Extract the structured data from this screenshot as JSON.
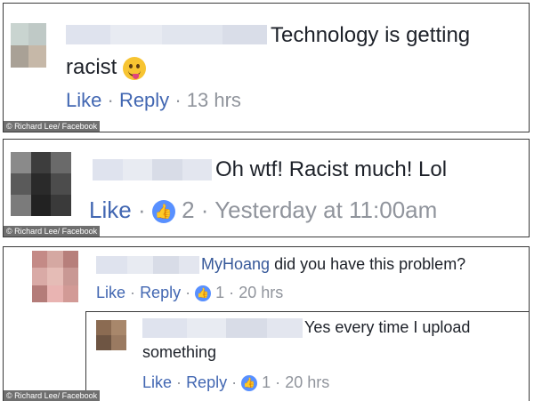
{
  "comments": [
    {
      "text_line1": "Technology is getting",
      "text_line2": "racist",
      "emoji": "tongue-out-emoji",
      "like": "Like",
      "reply": "Reply",
      "time": "13 hrs",
      "credit": "© Richard Lee/ Facebook"
    },
    {
      "text": "Oh wtf! Racist much! Lol",
      "like": "Like",
      "reaction_count": "2",
      "time": "Yesterday at 11:00am",
      "credit": "© Richard Lee/ Facebook"
    },
    {
      "mention": "MyHoang",
      "text": "did you have this problem?",
      "like": "Like",
      "reply": "Reply",
      "reaction_count": "1",
      "time": "20 hrs",
      "credit": "© Richard Lee/ Facebook",
      "reply_comment": {
        "text_line1": "Yes every time I upload",
        "text_line2": "something",
        "like": "Like",
        "reply": "Reply",
        "reaction_count": "1",
        "time": "20 hrs"
      }
    }
  ],
  "separator": "·",
  "icons": {
    "like": "thumbs-up-icon"
  },
  "colors": {
    "link": "#4267b2",
    "meta": "#90949c",
    "like_badge": "#5890ff",
    "credit_bg": "#6f6f6f"
  }
}
